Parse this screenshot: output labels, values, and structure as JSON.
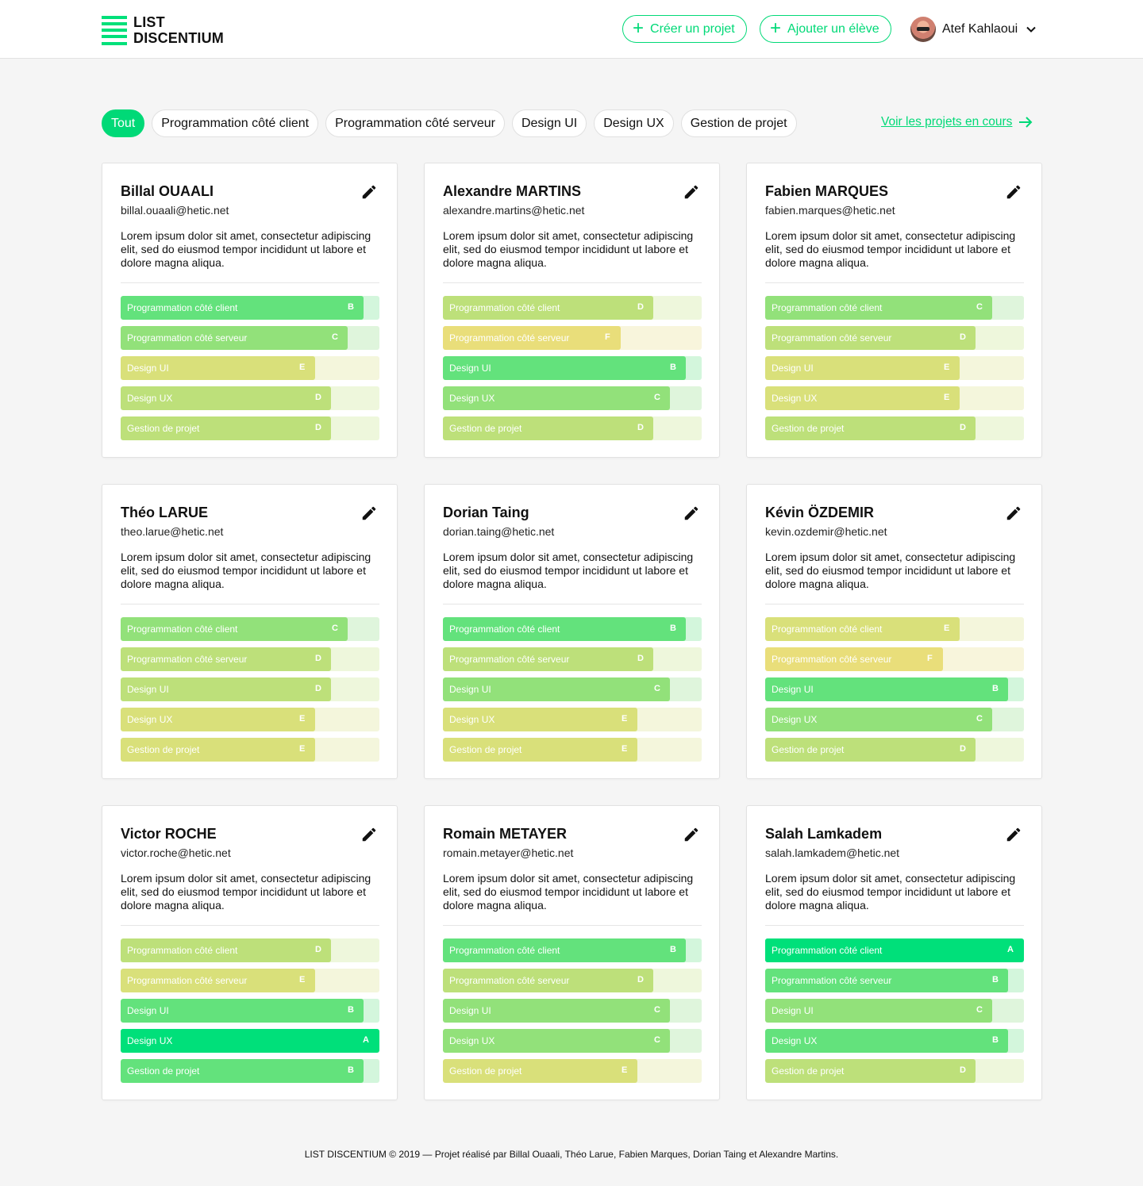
{
  "app": {
    "logo_line1": "LIST",
    "logo_line2": "DISCENTIUM"
  },
  "header": {
    "create_project": "Créer un projet",
    "add_student": "Ajouter un élève",
    "user_name": "Atef Kahlaoui"
  },
  "filters": {
    "items": [
      "Tout",
      "Programmation côté client",
      "Programmation côté serveur",
      "Design UI",
      "Design UX",
      "Gestion de projet"
    ],
    "active": "Tout",
    "see_projects": "Voir les projets en cours"
  },
  "grade_colors": {
    "A": {
      "fill": "#00e07a",
      "track": "#00e07a"
    },
    "B": {
      "fill": "#63e27c",
      "track": "#d3f6dc"
    },
    "C": {
      "fill": "#92e17a",
      "track": "#dff5dc"
    },
    "D": {
      "fill": "#bde07a",
      "track": "#eef7dc"
    },
    "E": {
      "fill": "#d9e07a",
      "track": "#f4f6dc"
    },
    "F": {
      "fill": "#e9de7a",
      "track": "#f8f5dc"
    }
  },
  "grade_levels": {
    "A": 1.0,
    "B": 0.94,
    "C": 0.88,
    "D": 0.815,
    "E": 0.755,
    "F": 0.69
  },
  "students": [
    {
      "name": "Billal OUAALI",
      "email": "billal.ouaali@hetic.net",
      "desc": "Lorem ipsum dolor sit amet, consectetur adipiscing elit, sed do eiusmod tempor incididunt ut labore et dolore magna aliqua.",
      "skills": [
        {
          "label": "Programmation côté client",
          "grade": "B"
        },
        {
          "label": "Programmation côté serveur",
          "grade": "C"
        },
        {
          "label": "Design UI",
          "grade": "E"
        },
        {
          "label": "Design UX",
          "grade": "D"
        },
        {
          "label": "Gestion de projet",
          "grade": "D"
        }
      ]
    },
    {
      "name": "Alexandre MARTINS",
      "email": "alexandre.martins@hetic.net",
      "desc": "Lorem ipsum dolor sit amet, consectetur adipiscing elit, sed do eiusmod tempor incididunt ut labore et dolore magna aliqua.",
      "skills": [
        {
          "label": "Programmation côté client",
          "grade": "D"
        },
        {
          "label": "Programmation côté serveur",
          "grade": "F"
        },
        {
          "label": "Design UI",
          "grade": "B"
        },
        {
          "label": "Design UX",
          "grade": "C"
        },
        {
          "label": "Gestion de projet",
          "grade": "D"
        }
      ]
    },
    {
      "name": "Fabien MARQUES",
      "email": "fabien.marques@hetic.net",
      "desc": "Lorem ipsum dolor sit amet, consectetur adipiscing elit, sed do eiusmod tempor incididunt ut labore et dolore magna aliqua.",
      "skills": [
        {
          "label": "Programmation côté client",
          "grade": "C"
        },
        {
          "label": "Programmation côté serveur",
          "grade": "D"
        },
        {
          "label": "Design UI",
          "grade": "E"
        },
        {
          "label": "Design UX",
          "grade": "E"
        },
        {
          "label": "Gestion de projet",
          "grade": "D"
        }
      ]
    },
    {
      "name": "Théo LARUE",
      "email": "theo.larue@hetic.net",
      "desc": "Lorem ipsum dolor sit amet, consectetur adipiscing elit, sed do eiusmod tempor incididunt ut labore et dolore magna aliqua.",
      "skills": [
        {
          "label": "Programmation côté client",
          "grade": "C"
        },
        {
          "label": "Programmation côté serveur",
          "grade": "D"
        },
        {
          "label": "Design UI",
          "grade": "D"
        },
        {
          "label": "Design UX",
          "grade": "E"
        },
        {
          "label": "Gestion de projet",
          "grade": "E"
        }
      ]
    },
    {
      "name": "Dorian Taing",
      "email": "dorian.taing@hetic.net",
      "desc": "Lorem ipsum dolor sit amet, consectetur adipiscing elit, sed do eiusmod tempor incididunt ut labore et dolore magna aliqua.",
      "skills": [
        {
          "label": "Programmation côté client",
          "grade": "B"
        },
        {
          "label": "Programmation côté serveur",
          "grade": "D"
        },
        {
          "label": "Design UI",
          "grade": "C"
        },
        {
          "label": "Design UX",
          "grade": "E"
        },
        {
          "label": "Gestion de projet",
          "grade": "E"
        }
      ]
    },
    {
      "name": "Kévin ÖZDEMIR",
      "email": "kevin.ozdemir@hetic.net",
      "desc": "Lorem ipsum dolor sit amet, consectetur adipiscing elit, sed do eiusmod tempor incididunt ut labore et dolore magna aliqua.",
      "skills": [
        {
          "label": "Programmation côté client",
          "grade": "E"
        },
        {
          "label": "Programmation côté serveur",
          "grade": "F"
        },
        {
          "label": "Design UI",
          "grade": "B"
        },
        {
          "label": "Design UX",
          "grade": "C"
        },
        {
          "label": "Gestion de projet",
          "grade": "D"
        }
      ]
    },
    {
      "name": "Victor ROCHE",
      "email": "victor.roche@hetic.net",
      "desc": "Lorem ipsum dolor sit amet, consectetur adipiscing elit, sed do eiusmod tempor incididunt ut labore et dolore magna aliqua.",
      "skills": [
        {
          "label": "Programmation côté client",
          "grade": "D"
        },
        {
          "label": "Programmation côté serveur",
          "grade": "E"
        },
        {
          "label": "Design UI",
          "grade": "B"
        },
        {
          "label": "Design UX",
          "grade": "A"
        },
        {
          "label": "Gestion de projet",
          "grade": "B"
        }
      ]
    },
    {
      "name": "Romain METAYER",
      "email": "romain.metayer@hetic.net",
      "desc": "Lorem ipsum dolor sit amet, consectetur adipiscing elit, sed do eiusmod tempor incididunt ut labore et dolore magna aliqua.",
      "skills": [
        {
          "label": "Programmation côté client",
          "grade": "B"
        },
        {
          "label": "Programmation côté serveur",
          "grade": "D"
        },
        {
          "label": "Design UI",
          "grade": "C"
        },
        {
          "label": "Design UX",
          "grade": "C"
        },
        {
          "label": "Gestion de projet",
          "grade": "E"
        }
      ]
    },
    {
      "name": "Salah Lamkadem",
      "email": "salah.lamkadem@hetic.net",
      "desc": "Lorem ipsum dolor sit amet, consectetur adipiscing elit, sed do eiusmod tempor incididunt ut labore et dolore magna aliqua.",
      "skills": [
        {
          "label": "Programmation côté client",
          "grade": "A"
        },
        {
          "label": "Programmation côté serveur",
          "grade": "B"
        },
        {
          "label": "Design UI",
          "grade": "C"
        },
        {
          "label": "Design UX",
          "grade": "B"
        },
        {
          "label": "Gestion de projet",
          "grade": "D"
        }
      ]
    }
  ],
  "footer": {
    "text": "LIST DISCENTIUM © 2019 — Projet réalisé par Billal Ouaali, Théo Larue, Fabien Marques, Dorian Taing et Alexandre Martins."
  },
  "colors": {
    "accent": "#00d977"
  }
}
